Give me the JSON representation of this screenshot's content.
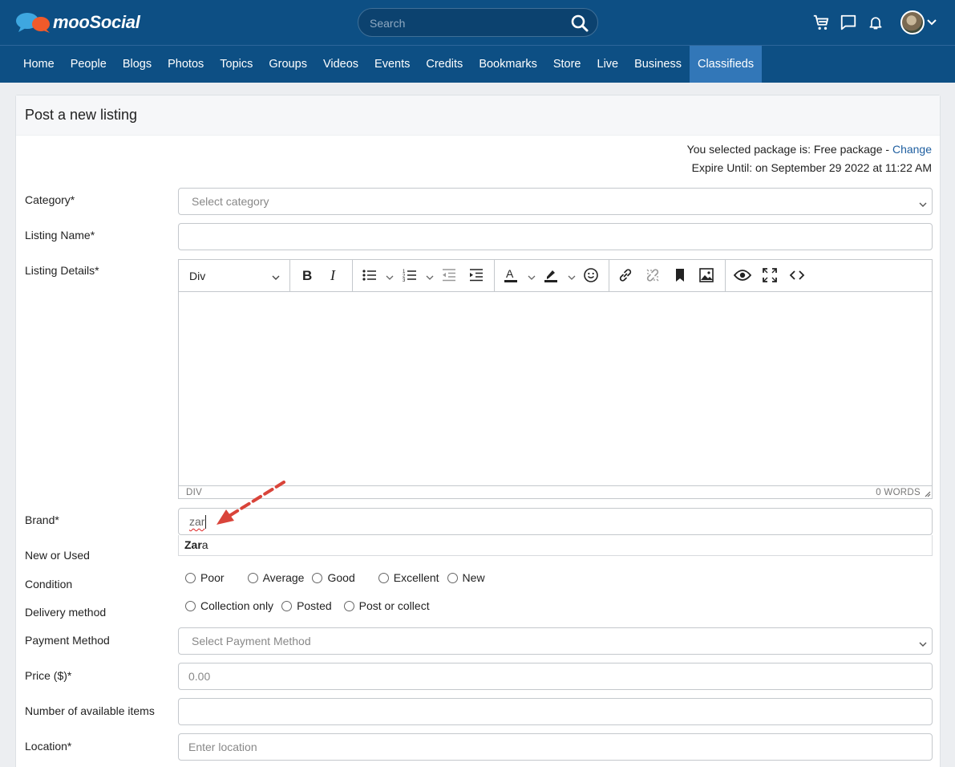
{
  "header": {
    "logo_text": "mooSocial",
    "search_placeholder": "Search",
    "icons": [
      "cart-icon",
      "chat-icon",
      "bell-icon",
      "avatar",
      "chevron-down-icon"
    ]
  },
  "nav": {
    "items": [
      "Home",
      "People",
      "Blogs",
      "Photos",
      "Topics",
      "Groups",
      "Videos",
      "Events",
      "Credits",
      "Bookmarks",
      "Store",
      "Live",
      "Business",
      "Classifieds"
    ],
    "active": "Classifieds"
  },
  "page": {
    "title": "Post a new listing",
    "package_prefix": "You selected package is: Free package - ",
    "package_change": "Change",
    "expire": "Expire Until: on September 29 2022 at 11:22 AM"
  },
  "form": {
    "category": {
      "label": "Category*",
      "placeholder": "Select category"
    },
    "listing_name": {
      "label": "Listing Name*",
      "value": ""
    },
    "listing_details": {
      "label": "Listing Details*",
      "block_format": "Div",
      "status_path": "DIV",
      "word_count": "0 WORDS",
      "toolbar_icons": [
        "bold-icon",
        "italic-icon",
        "bullet-list-icon",
        "numbered-list-icon",
        "outdent-icon",
        "indent-icon",
        "text-color-icon",
        "highlight-icon",
        "emoji-icon",
        "link-icon",
        "unlink-icon",
        "bookmark-icon",
        "image-icon",
        "preview-icon",
        "fullscreen-icon",
        "source-code-icon"
      ]
    },
    "brand": {
      "label": "Brand*",
      "value": "zar",
      "suggestion_match": "Zar",
      "suggestion_rest": "a"
    },
    "new_or_used": {
      "label": "New or Used"
    },
    "condition": {
      "label": "Condition",
      "options": [
        "Poor",
        "Average",
        "Good",
        "Excellent",
        "New"
      ]
    },
    "delivery": {
      "label": "Delivery method",
      "options": [
        "Collection only",
        "Posted",
        "Post or collect"
      ]
    },
    "payment": {
      "label": "Payment Method",
      "placeholder": "Select Payment Method"
    },
    "price": {
      "label": "Price ($)*",
      "placeholder": "0.00"
    },
    "items": {
      "label": "Number of available items",
      "value": ""
    },
    "location": {
      "label": "Location*",
      "placeholder": "Enter location"
    }
  },
  "colors": {
    "header_bg": "#0d4f84",
    "active_nav": "#3277b8",
    "link": "#1f5fa0",
    "annotation_arrow": "#d9443a"
  }
}
